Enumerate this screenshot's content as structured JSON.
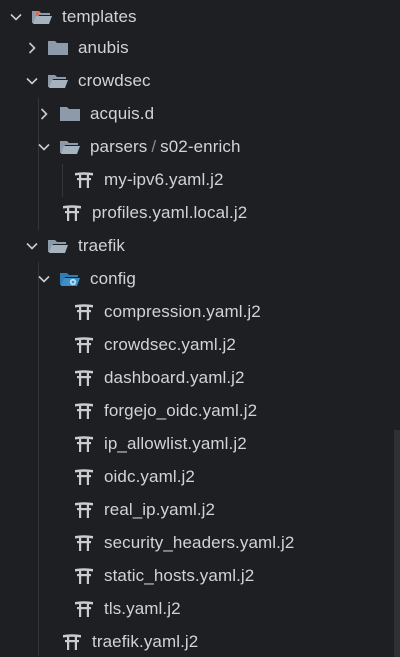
{
  "tree": {
    "root": {
      "label": "templates",
      "expanded": true,
      "icon": "folder-open-icon"
    },
    "anubis": {
      "label": "anubis",
      "expanded": false,
      "icon": "folder-icon"
    },
    "crowdsec": {
      "label": "crowdsec",
      "expanded": true,
      "icon": "folder-open-icon"
    },
    "acquis": {
      "label": "acquis.d",
      "expanded": false,
      "icon": "folder-icon"
    },
    "parsers": {
      "label": "parsers",
      "separator": "/",
      "sub_label": "s02-enrich",
      "expanded": true,
      "icon": "folder-open-icon"
    },
    "my_ipv6": {
      "label": "my-ipv6.yaml.j2",
      "icon": "jinja-file-icon"
    },
    "profiles": {
      "label": "profiles.yaml.local.j2",
      "icon": "jinja-file-icon"
    },
    "traefik": {
      "label": "traefik",
      "expanded": true,
      "icon": "folder-open-icon"
    },
    "config": {
      "label": "config",
      "expanded": true,
      "icon": "config-folder-open-icon"
    },
    "config_files": [
      {
        "label": "compression.yaml.j2",
        "icon": "jinja-file-icon"
      },
      {
        "label": "crowdsec.yaml.j2",
        "icon": "jinja-file-icon"
      },
      {
        "label": "dashboard.yaml.j2",
        "icon": "jinja-file-icon"
      },
      {
        "label": "forgejo_oidc.yaml.j2",
        "icon": "jinja-file-icon"
      },
      {
        "label": "ip_allowlist.yaml.j2",
        "icon": "jinja-file-icon"
      },
      {
        "label": "oidc.yaml.j2",
        "icon": "jinja-file-icon"
      },
      {
        "label": "real_ip.yaml.j2",
        "icon": "jinja-file-icon"
      },
      {
        "label": "security_headers.yaml.j2",
        "icon": "jinja-file-icon"
      },
      {
        "label": "static_hosts.yaml.j2",
        "icon": "jinja-file-icon"
      },
      {
        "label": "tls.yaml.j2",
        "icon": "jinja-file-icon"
      }
    ],
    "traefik_yaml": {
      "label": "traefik.yaml.j2",
      "icon": "jinja-file-icon"
    }
  },
  "colors": {
    "background": "#1e1f22",
    "text": "#d0d3d8",
    "folder": "#8c9aaa",
    "config_folder": "#3d8fc6",
    "jinja_icon": "#c9ccd1"
  }
}
